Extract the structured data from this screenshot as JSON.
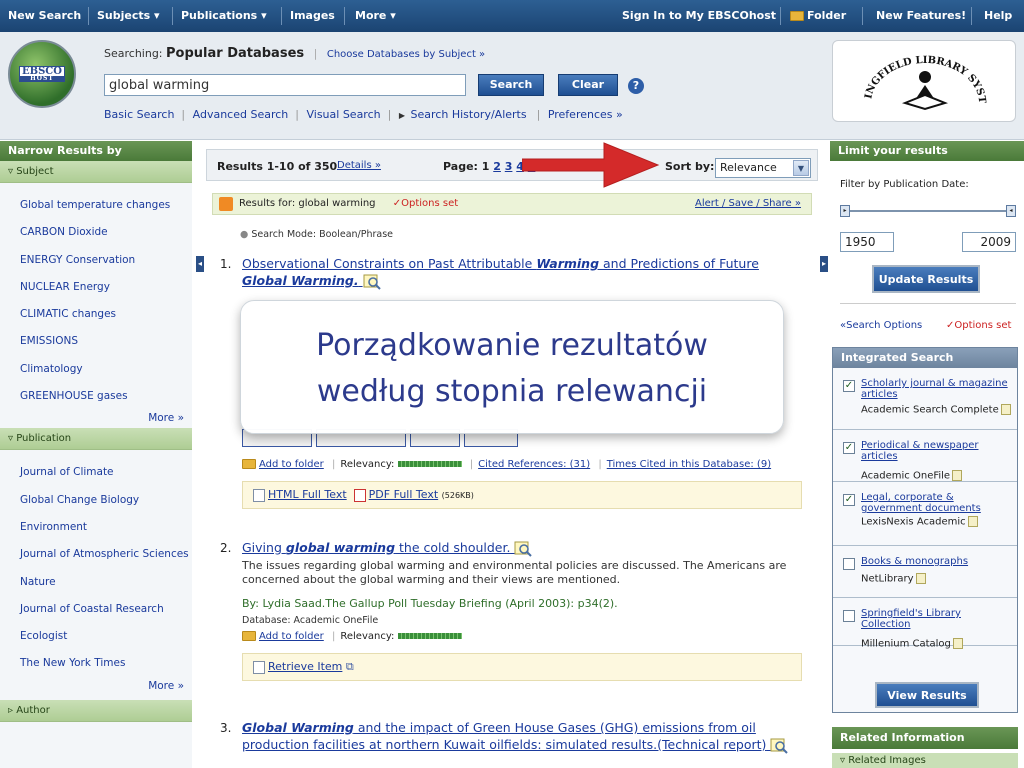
{
  "nav": {
    "new_search": "New Search",
    "subjects": "Subjects",
    "publications": "Publications",
    "images": "Images",
    "more": "More",
    "sign_in": "Sign In to My EBSCOhost",
    "folder": "Folder",
    "new_features": "New Features!",
    "help": "Help"
  },
  "header": {
    "logo_top": "EBSCO",
    "logo_bottom": "HOST",
    "searching_label": "Searching:",
    "database": "Popular Databases",
    "choose_db": "Choose Databases by Subject »",
    "search_value": "global warming",
    "search_btn": "Search",
    "clear_btn": "Clear",
    "help_icon": "?",
    "links": [
      "Basic Search",
      "Advanced Search",
      "Visual Search",
      "Search History/Alerts",
      "Preferences »"
    ],
    "library_name": "SPRINGFIELD LIBRARY SYSTEM"
  },
  "left": {
    "title": "Narrow Results by",
    "subject_head": "Subject",
    "subjects": [
      "Global temperature changes",
      "CARBON Dioxide",
      "ENERGY Conservation",
      "NUCLEAR Energy",
      "CLIMATIC changes",
      "EMISSIONS",
      "Climatology",
      "GREENHOUSE gases"
    ],
    "more": "More »",
    "publication_head": "Publication",
    "publications": [
      "Journal of Climate",
      "Global Change Biology",
      "Environment",
      "Journal of Atmospheric Sciences",
      "Nature",
      "Journal of Coastal Research",
      "Ecologist",
      "The New York Times"
    ],
    "author_head": "Author"
  },
  "main": {
    "results_count": "Results 1-10 of 350",
    "details": "Details »",
    "page_label": "Page: 1",
    "pages": [
      "2",
      "3",
      "4",
      "5"
    ],
    "sort_label": "Sort by:",
    "sort_value": "Relevance",
    "results_for": "Results for: global warming",
    "options_set": "✓Options set",
    "alert_links": "Alert / Save / Share »",
    "search_mode": "Search Mode: Boolean/Phrase",
    "r1": {
      "num": "1.",
      "title_a": "Observational Constraints on Past Attributable ",
      "title_b": "Warming",
      "title_c": " and Predictions of Future ",
      "title_d": "Global Warming.",
      "add_folder": "Add to folder",
      "relevancy": "Relevancy:",
      "cited": "Cited References: (31)",
      "times_cited": "Times Cited in this Database: (9)",
      "html": "HTML Full Text",
      "pdf": "PDF Full Text",
      "pdf_size": "(526KB)"
    },
    "r2": {
      "num": "2.",
      "title_a": "Giving ",
      "title_b": "global warming",
      "title_c": " the cold shoulder.",
      "abstract": "The issues regarding global warming and environmental policies are discussed. The Americans are concerned about the global warming and their views are mentioned.",
      "byline": "By: Lydia Saad.The Gallup Poll Tuesday Briefing (April 2003): p34(2).",
      "database": "Database: Academic OneFile",
      "add_folder": "Add to folder",
      "relevancy": "Relevancy:",
      "retrieve": "Retrieve Item"
    },
    "r3": {
      "num": "3.",
      "title_a": "Global Warming",
      "title_b": " and the impact of Green House Gases (GHG) emissions from oil production facilities at northern Kuwait oilfields: simulated results.(Technical report)"
    }
  },
  "overlay": {
    "line1": "Porządkowanie rezultatów",
    "line2": "według stopnia relewancji"
  },
  "right": {
    "limit_head": "Limit your results",
    "filter_label": "Filter by Publication Date:",
    "date_from": "1950",
    "date_to": "2009",
    "update_btn": "Update Results",
    "search_options": "«Search Options",
    "options_set": "✓Options set",
    "integrated_head": "Integrated Search",
    "items": [
      {
        "label": "Scholarly journal & magazine articles",
        "source": "Academic Search Complete",
        "checked": "✓"
      },
      {
        "label": "Periodical & newspaper articles",
        "source": "Academic OneFile",
        "checked": "✓"
      },
      {
        "label": "Legal, corporate & government documents",
        "source": "LexisNexis Academic",
        "checked": "✓"
      },
      {
        "label": "Books & monographs",
        "source": "NetLibrary",
        "checked": ""
      },
      {
        "label": "Springfield's Library Collection",
        "source": "Millenium Catalog",
        "checked": ""
      }
    ],
    "view_btn": "View Results",
    "related_head": "Related Information",
    "related_images": "Related Images"
  },
  "colors": {
    "nav": "#1b4472",
    "green_head": "#4f7d3f",
    "accent_red": "#d42a2a"
  }
}
